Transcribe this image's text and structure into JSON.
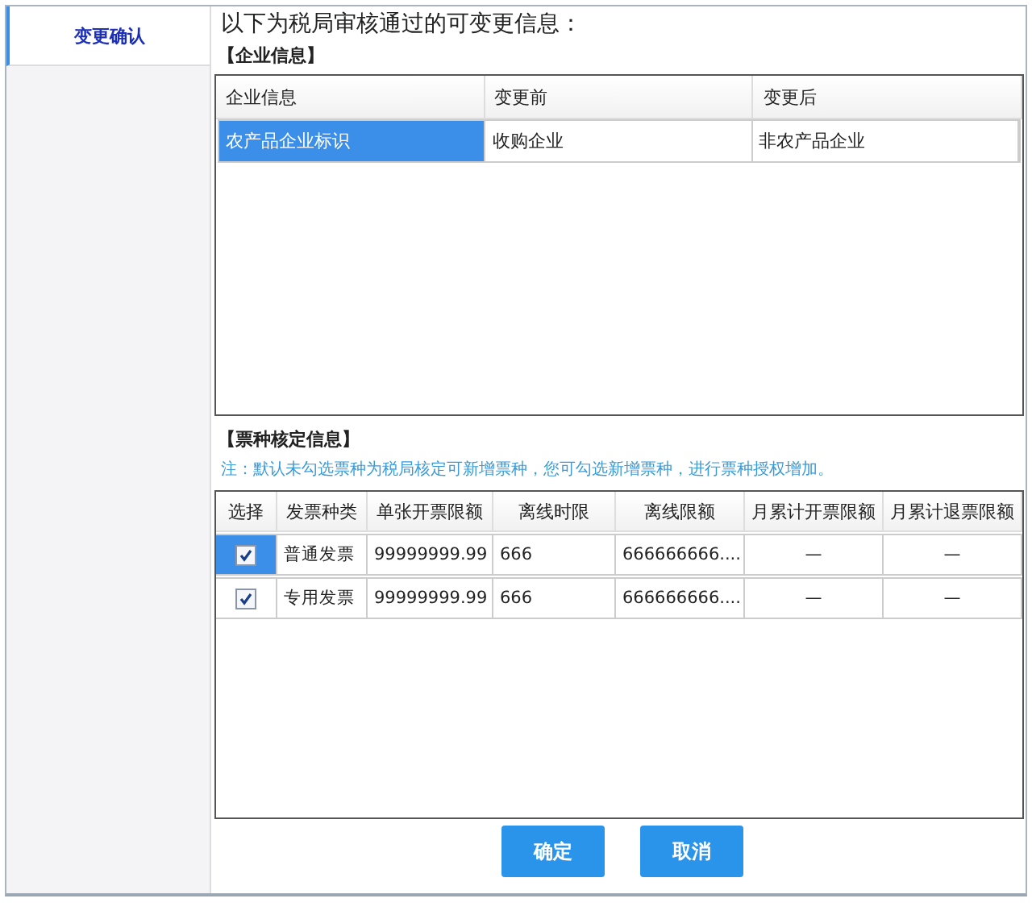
{
  "sidebar": {
    "tabs": [
      {
        "label": "变更确认",
        "selected": true
      }
    ]
  },
  "heading": "以下为税局审核通过的可变更信息：",
  "enterprise": {
    "title": "【企业信息】",
    "columns": [
      "企业信息",
      "变更前",
      "变更后"
    ],
    "rows": [
      {
        "selected": true,
        "cells": [
          "农产品企业标识",
          "收购企业",
          "非农产品企业"
        ]
      }
    ]
  },
  "tickets": {
    "title": "【票种核定信息】",
    "note": "注：默认未勾选票种为税局核定可新增票种，您可勾选新增票种，进行票种授权增加。",
    "columns": [
      "选择",
      "发票种类",
      "单张开票限额",
      "离线时限",
      "离线限额",
      "月累计开票限额",
      "月累计退票限额"
    ],
    "rows": [
      {
        "selected": true,
        "checked": true,
        "cells": [
          "",
          "普通发票",
          "99999999.99",
          "666",
          "666666666....",
          "—",
          "—"
        ]
      },
      {
        "selected": false,
        "checked": true,
        "cells": [
          "",
          "专用发票",
          "99999999.99",
          "666",
          "666666666....",
          "—",
          "—"
        ]
      }
    ]
  },
  "buttons": [
    "确定",
    "取消"
  ]
}
